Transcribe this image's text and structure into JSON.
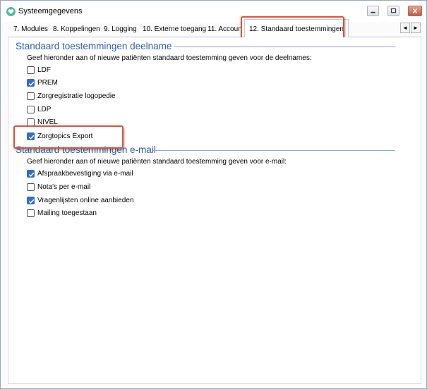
{
  "window": {
    "title": "Systeemgegevens",
    "controls": {
      "minimize": "minimize",
      "maximize": "maximize",
      "close": "close"
    }
  },
  "tabs": [
    {
      "label": "7. Modules",
      "active": false
    },
    {
      "label": "8. Koppelingen",
      "active": false
    },
    {
      "label": "9. Logging",
      "active": false
    },
    {
      "label": "10. Externe toegang",
      "active": false
    },
    {
      "label": "11. Accoun",
      "active": false
    },
    {
      "label": "12. Standaard toestemmingen",
      "active": true
    }
  ],
  "tab_scroll": {
    "left": "◄",
    "right": "►"
  },
  "sections": [
    {
      "title": "Standaard toestemmingen deelname",
      "description": "Geef hieronder aan of nieuwe patiënten standaard toestemming geven voor de deelnames:",
      "options": [
        {
          "label": "LDF",
          "checked": false
        },
        {
          "label": "PREM",
          "checked": true
        },
        {
          "label": "Zorgregistratie logopedie",
          "checked": false
        },
        {
          "label": "LDP",
          "checked": false
        },
        {
          "label": "NIVEL",
          "checked": false
        },
        {
          "label": "Zorgtopics Export",
          "checked": true
        }
      ]
    },
    {
      "title": "Standaard toestemmingen e-mail",
      "description": "Geef hieronder aan of nieuwe patiënten standaard toestemming geven voor e-mail:",
      "options": [
        {
          "label": "Afspraakbevestiging via e-mail",
          "checked": true
        },
        {
          "label": "Nota's per e-mail",
          "checked": false
        },
        {
          "label": "Vragenlijsten online aanbieden",
          "checked": true
        },
        {
          "label": "Mailing toegestaan",
          "checked": false
        }
      ]
    }
  ],
  "colors": {
    "accent": "#2a62b9",
    "checkbox_checked": "#2f6fc9",
    "highlight": "#e0523c"
  }
}
